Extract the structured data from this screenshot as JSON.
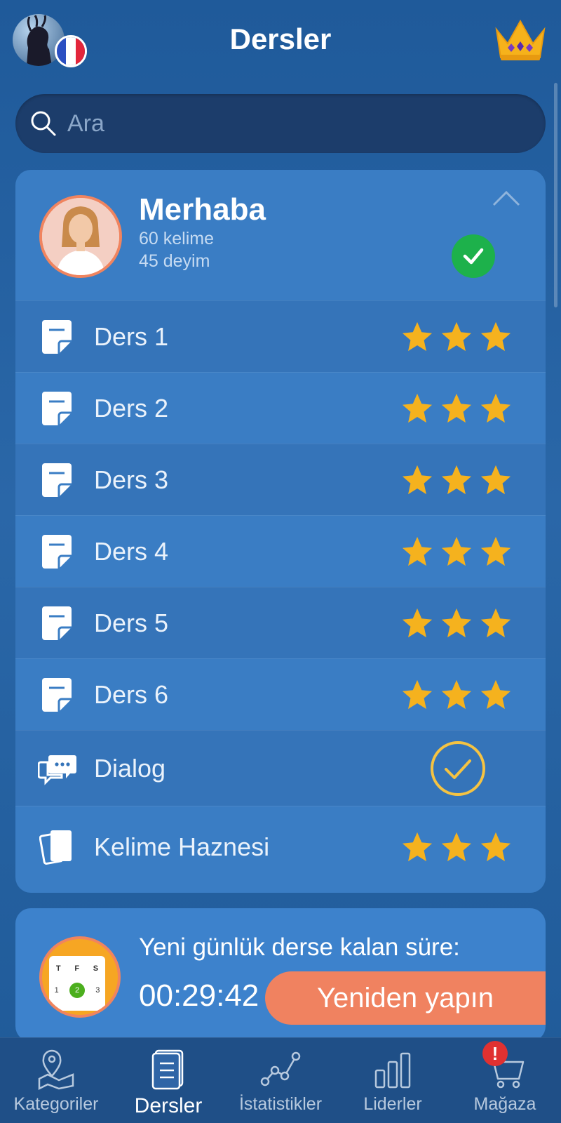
{
  "header": {
    "title": "Dersler"
  },
  "search": {
    "placeholder": "Ara"
  },
  "lesson_group": {
    "title": "Merhaba",
    "words": "60 kelime",
    "idioms": "45 deyim",
    "completed": true
  },
  "lessons": [
    {
      "label": "Ders 1",
      "stars": 3
    },
    {
      "label": "Ders 2",
      "stars": 3
    },
    {
      "label": "Ders 3",
      "stars": 3
    },
    {
      "label": "Ders 4",
      "stars": 3
    },
    {
      "label": "Ders 5",
      "stars": 3
    },
    {
      "label": "Ders 6",
      "stars": 3
    }
  ],
  "dialog": {
    "label": "Dialog",
    "completed": true
  },
  "vocabulary": {
    "label": "Kelime Haznesi",
    "stars": 3
  },
  "daily": {
    "text": "Yeni günlük derse kalan süre:",
    "timer": "00:29:42",
    "button": "Yeniden yapın",
    "calendar": {
      "days": [
        "T",
        "F",
        "S"
      ],
      "dates": [
        "1",
        "2",
        "3"
      ]
    }
  },
  "nav": {
    "items": [
      {
        "label": "Kategoriler",
        "icon": "map-pin-icon"
      },
      {
        "label": "Dersler",
        "icon": "book-icon",
        "active": true
      },
      {
        "label": "İstatistikler",
        "icon": "stats-icon"
      },
      {
        "label": "Liderler",
        "icon": "leaderboard-icon"
      },
      {
        "label": "Mağaza",
        "icon": "cart-icon",
        "badge": "!"
      }
    ]
  },
  "colors": {
    "star": "#f5b21e",
    "success": "#1db14b",
    "accent": "#f08260",
    "card": "#3a7dc4"
  }
}
